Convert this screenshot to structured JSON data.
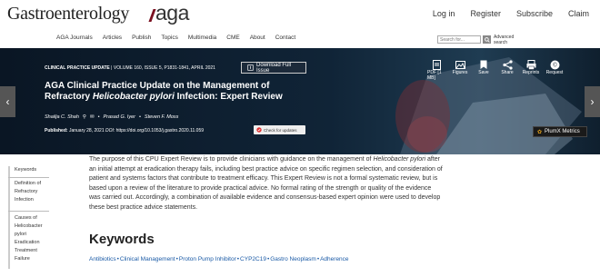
{
  "header": {
    "logo_text": "Gastroenterology",
    "logo_aga": "aga",
    "links": [
      "Log in",
      "Register",
      "Subscribe",
      "Claim"
    ]
  },
  "nav": {
    "items": [
      "AGA Journals",
      "Articles",
      "Publish",
      "Topics",
      "Multimedia",
      "CME",
      "About",
      "Contact"
    ],
    "search_placeholder": "Search for...",
    "advanced_search": "Advanced search"
  },
  "article": {
    "section_label": "CLINICAL PRACTICE UPDATE",
    "volume_info": "VOLUME 160, ISSUE 5, P1831-1841, APRIL 2021",
    "download_label": "Download Full Issue",
    "title_part1": "AGA Clinical Practice Update on the Management of Refractory ",
    "title_italic": "Helicobacter pylori",
    "title_part2": " Infection: Expert Review",
    "authors": [
      "Shailja C. Shah",
      "Prasad G. Iyer",
      "Steven F. Moss"
    ],
    "published_label": "Published:",
    "published_date": "January 28, 2021",
    "doi_label": "DOI:",
    "doi": "https://doi.org/10.1053/j.gastro.2020.11.059",
    "check_updates": "Check for updates",
    "plumx": "PlumX Metrics"
  },
  "actions": [
    {
      "label": "PDF [1 MB]",
      "icon": "pdf-icon"
    },
    {
      "label": "Figures",
      "icon": "figures-icon"
    },
    {
      "label": "Save",
      "icon": "save-icon"
    },
    {
      "label": "Share",
      "icon": "share-icon"
    },
    {
      "label": "Reprints",
      "icon": "reprints-icon"
    },
    {
      "label": "Request",
      "icon": "request-icon"
    }
  ],
  "sidebar": {
    "items": [
      "Keywords",
      "Definition of Refractory Infection",
      "Causes of Helicobacter pylori Eradication Treatment Failure"
    ]
  },
  "abstract": {
    "part1": "The purpose of this CPU Expert Review is to provide clinicians with guidance on the management of ",
    "italic": "Helicobacter pylori",
    "part2": " after an initial attempt at eradication therapy fails, including best practice advice on specific regimen selection, and consideration of patient and systems factors that contribute to treatment efficacy. This Expert Review is not a formal systematic review, but is based upon a review of the literature to provide practical advice. No formal rating of the strength or quality of the evidence was carried out. Accordingly, a combination of available evidence and consensus-based expert opinion were used to develop these best practice advice statements."
  },
  "keywords": {
    "heading": "Keywords",
    "items": [
      "Antibiotics",
      "Clinical Management",
      "Proton Pump Inhibitor",
      "CYP2C19",
      "Gastro Neoplasm",
      "Adherence"
    ]
  },
  "colors": {
    "banner_bg": "#0d1b2a",
    "link_blue": "#1a5aa6",
    "aga_accent": "#7a1020"
  }
}
